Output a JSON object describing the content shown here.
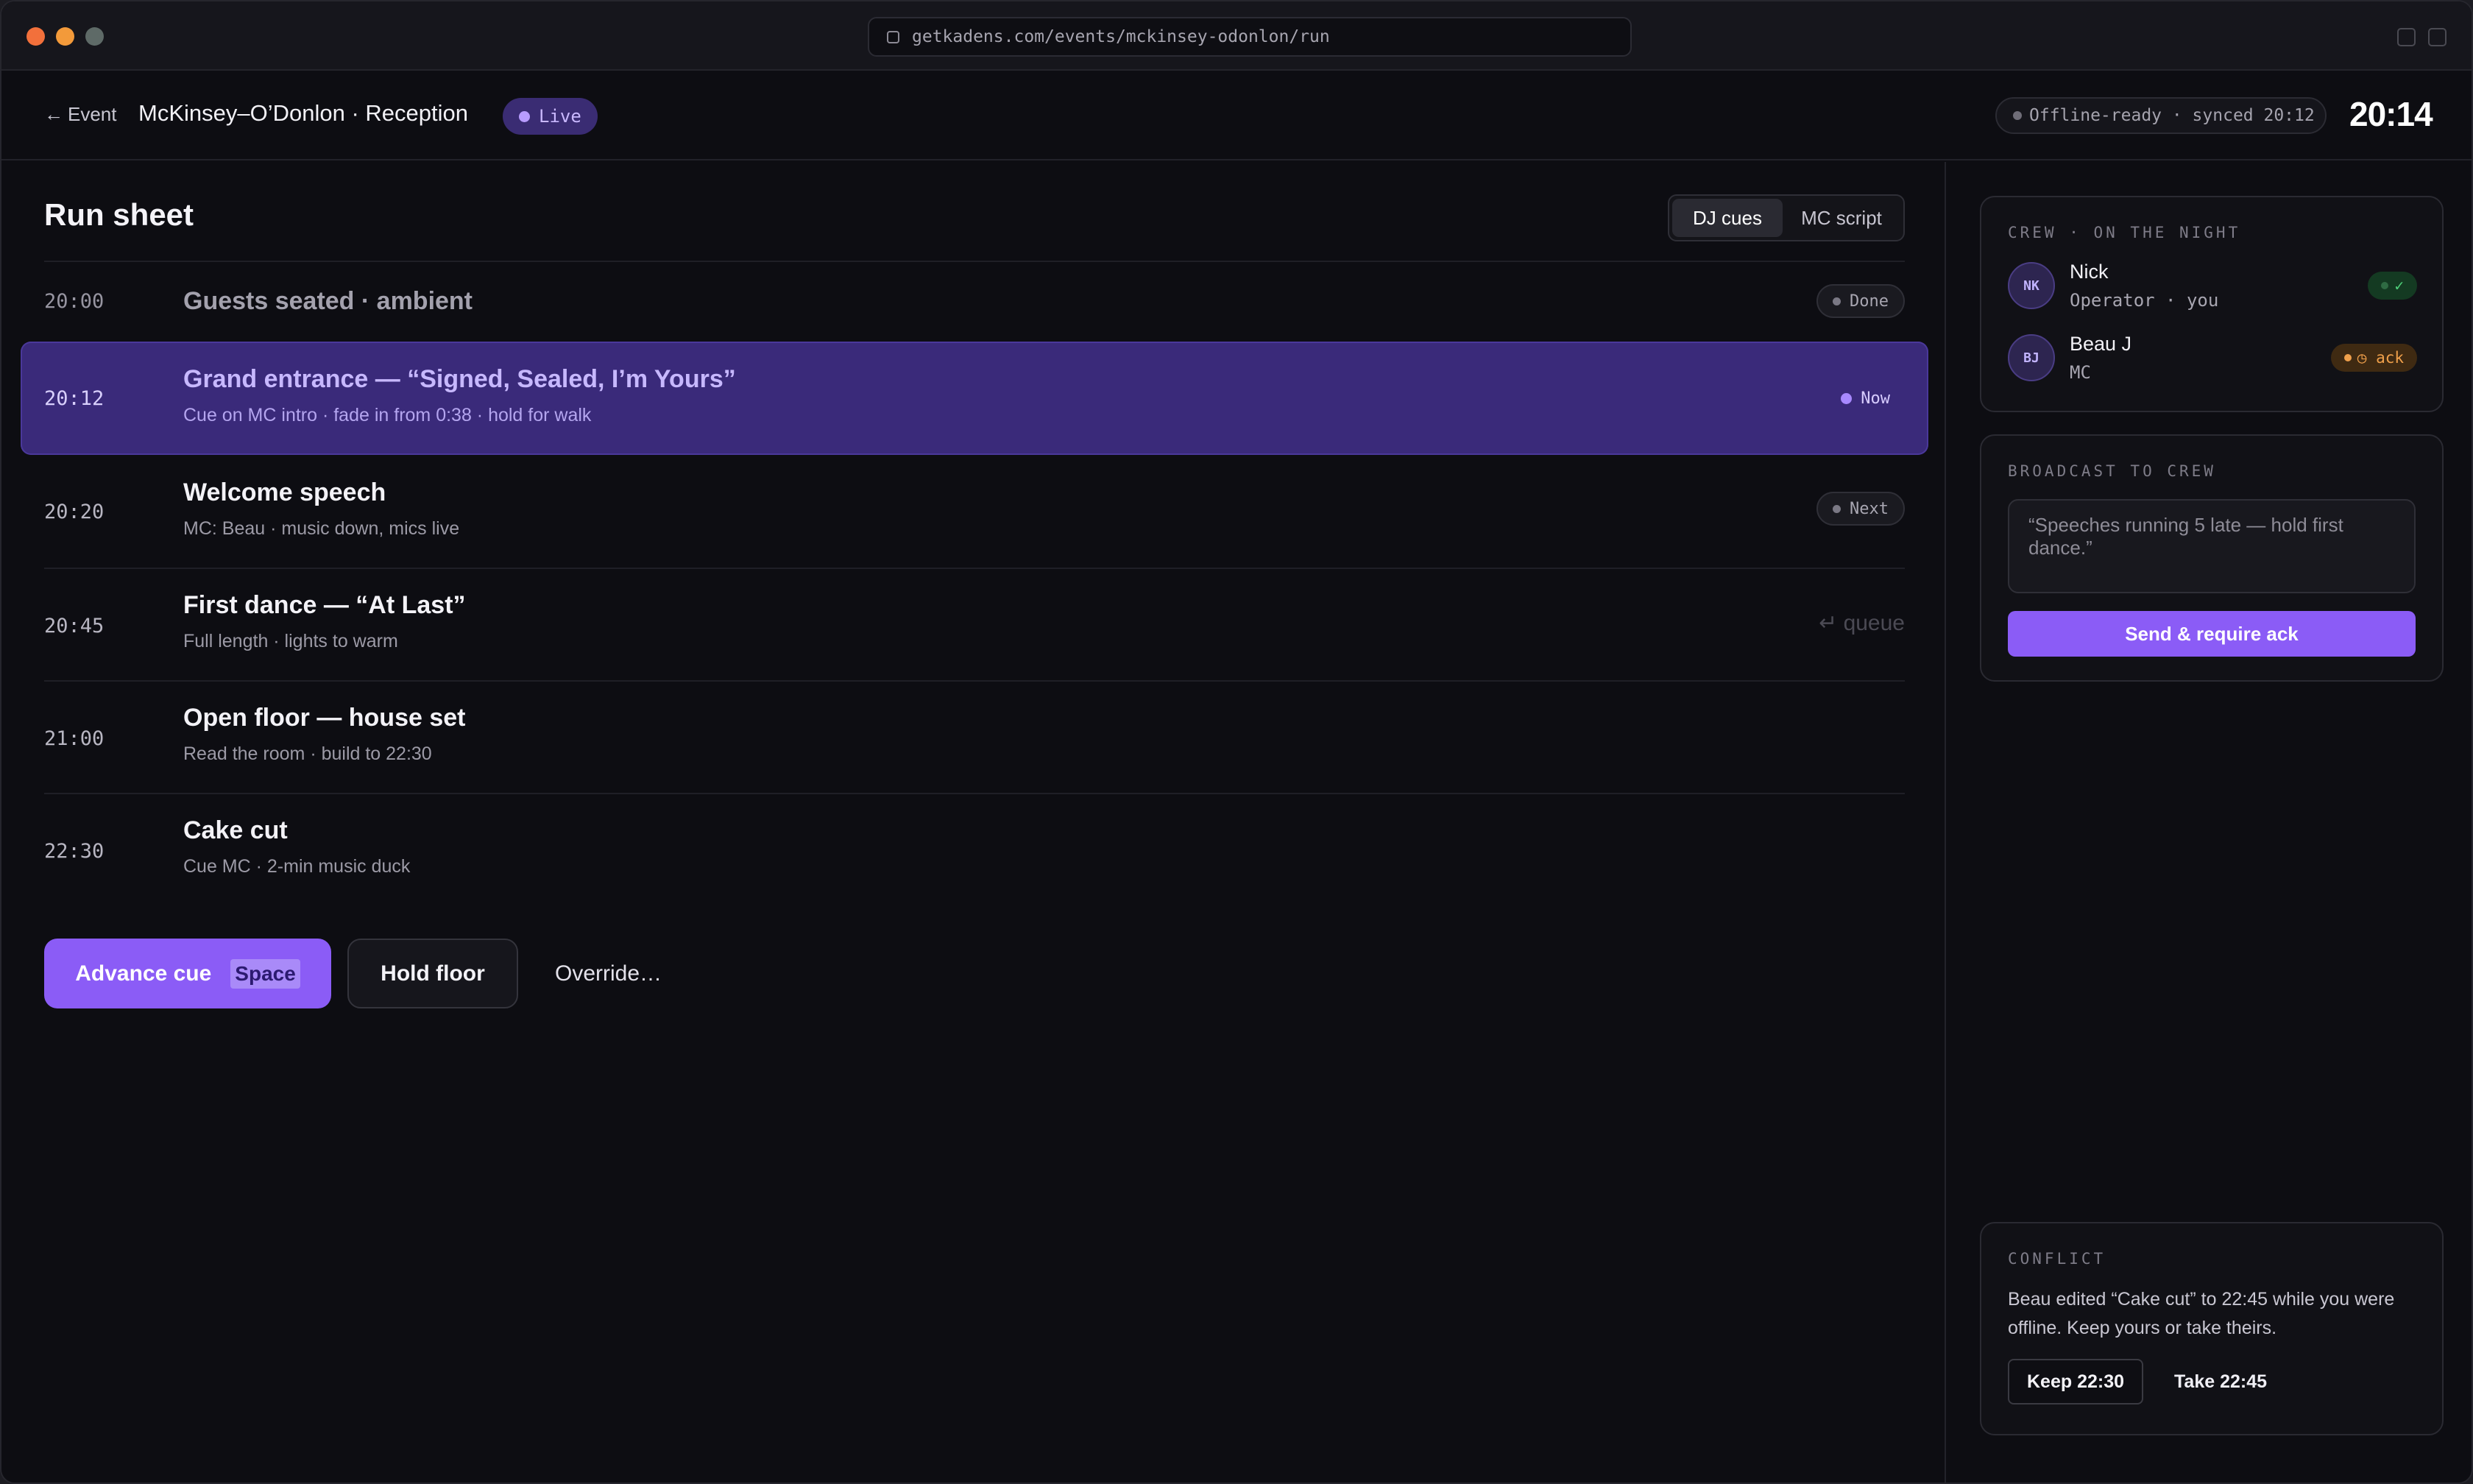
{
  "browser": {
    "url": "getkadens.com/events/mckinsey-odonlon/run"
  },
  "header": {
    "back_label": "Event",
    "event_title": "McKinsey–O’Donlon · Reception",
    "live_label": "Live",
    "sync_status": "Offline-ready · synced 20:12",
    "clock": "20:14"
  },
  "run_sheet": {
    "title": "Run sheet",
    "tabs": [
      {
        "label": "DJ cues",
        "active": true
      },
      {
        "label": "MC script",
        "active": false
      }
    ],
    "cues": [
      {
        "time": "20:00",
        "title": "Guests seated · ambient",
        "subtitle": "",
        "status": "Done"
      },
      {
        "time": "20:12",
        "title": "Grand entrance — “Signed, Sealed, I’m Yours”",
        "subtitle": "Cue on MC intro · fade in from 0:38 · hold for walk",
        "status": "Now"
      },
      {
        "time": "20:20",
        "title": "Welcome speech",
        "subtitle": "MC: Beau · music down, mics live",
        "status": "Next"
      },
      {
        "time": "20:45",
        "title": "First dance — “At Last”",
        "subtitle": "Full length · lights to warm",
        "status": "",
        "hint": "↵ queue"
      },
      {
        "time": "21:00",
        "title": "Open floor — house set",
        "subtitle": "Read the room · build to 22:30",
        "status": ""
      },
      {
        "time": "22:30",
        "title": "Cake cut",
        "subtitle": "Cue MC · 2-min music duck",
        "status": ""
      }
    ],
    "actions": {
      "advance_label": "Advance cue",
      "advance_key": "Space",
      "hold_label": "Hold floor",
      "override_label": "Override…"
    }
  },
  "crew": {
    "label": "CREW · ON THE NIGHT",
    "members": [
      {
        "initials": "NK",
        "name": "Nick",
        "role": "Operator · you",
        "ack": "✓",
        "ack_state": "ok"
      },
      {
        "initials": "BJ",
        "name": "Beau J",
        "role": "MC",
        "ack": "◷ ack",
        "ack_state": "pending"
      }
    ]
  },
  "broadcast": {
    "label": "BROADCAST TO CREW",
    "placeholder": "“Speeches running 5 late — hold first dance.”",
    "send_label": "Send & require ack"
  },
  "conflict": {
    "label": "CONFLICT",
    "message": "Beau edited “Cake cut” to 22:45 while you were offline. Keep yours or take theirs.",
    "keep_label": "Keep 22:30",
    "take_label": "Take 22:45"
  },
  "colors": {
    "accent": "#8b5cf6",
    "now_row": "#3a2a7a",
    "ack_ok": "#4fd17a",
    "ack_pending": "#f0a04b"
  }
}
